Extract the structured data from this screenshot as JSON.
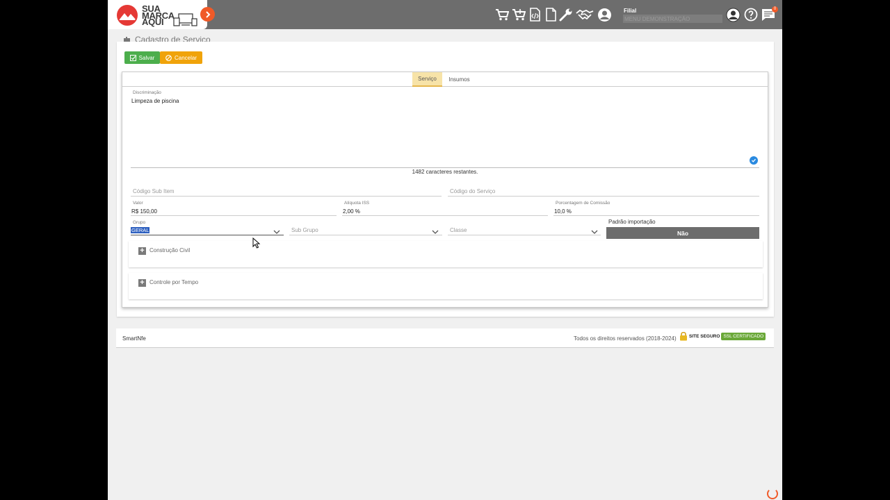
{
  "header": {
    "logo": {
      "line1": "SUA",
      "line2": "MARCA",
      "line3": "AQUI",
      "color": "#e53935"
    },
    "icons": [
      "cart-icon",
      "cart-add-icon",
      "code-document-icon",
      "document-icon",
      "wrench-icon",
      "handshake-icon",
      "user-circle-icon"
    ],
    "filial_label": "Filial",
    "filial_value": "MENU DEMONSTRAÇÃO",
    "right_icons": [
      "profile-icon",
      "help-icon",
      "chat-icon"
    ],
    "notification_count": "0",
    "accent": "#f05a28"
  },
  "page": {
    "title": "Cadastro de Serviço",
    "save_label": "Salvar",
    "cancel_label": "Cancelar"
  },
  "tabs": [
    {
      "label": "Serviço",
      "active": true
    },
    {
      "label": "Insumos",
      "active": false
    }
  ],
  "form": {
    "discriminacao_label": "Discriminação",
    "discriminacao_value": "Limpeza de piscina",
    "char_count": "1482 caracteres restantes.",
    "codigo_sub_item_placeholder": "Código Sub Item",
    "codigo_servico_placeholder": "Código do Serviço",
    "valor_label": "Valor",
    "valor_value": "R$ 150,00",
    "aliquota_label": "Alíquota ISS",
    "aliquota_value": "2,00 %",
    "comissao_label": "Porcentagem de Comissão",
    "comissao_value": "10,0 %",
    "grupo_label": "Grupo",
    "grupo_value": "GERAL",
    "subgrupo_placeholder": "Sub Grupo",
    "classe_placeholder": "Classe",
    "padrao_label": "Padrão importação",
    "padrao_value": "Não"
  },
  "sections": [
    {
      "label": "Construção Civil"
    },
    {
      "label": "Controle por Tempo"
    }
  ],
  "footer": {
    "brand": "SmartNfe",
    "rights": "Todos os direitos reservados (2018-2024)",
    "seal_text": "SITE SEGURO",
    "ssl_text": "SSL CERTIFICADO"
  }
}
